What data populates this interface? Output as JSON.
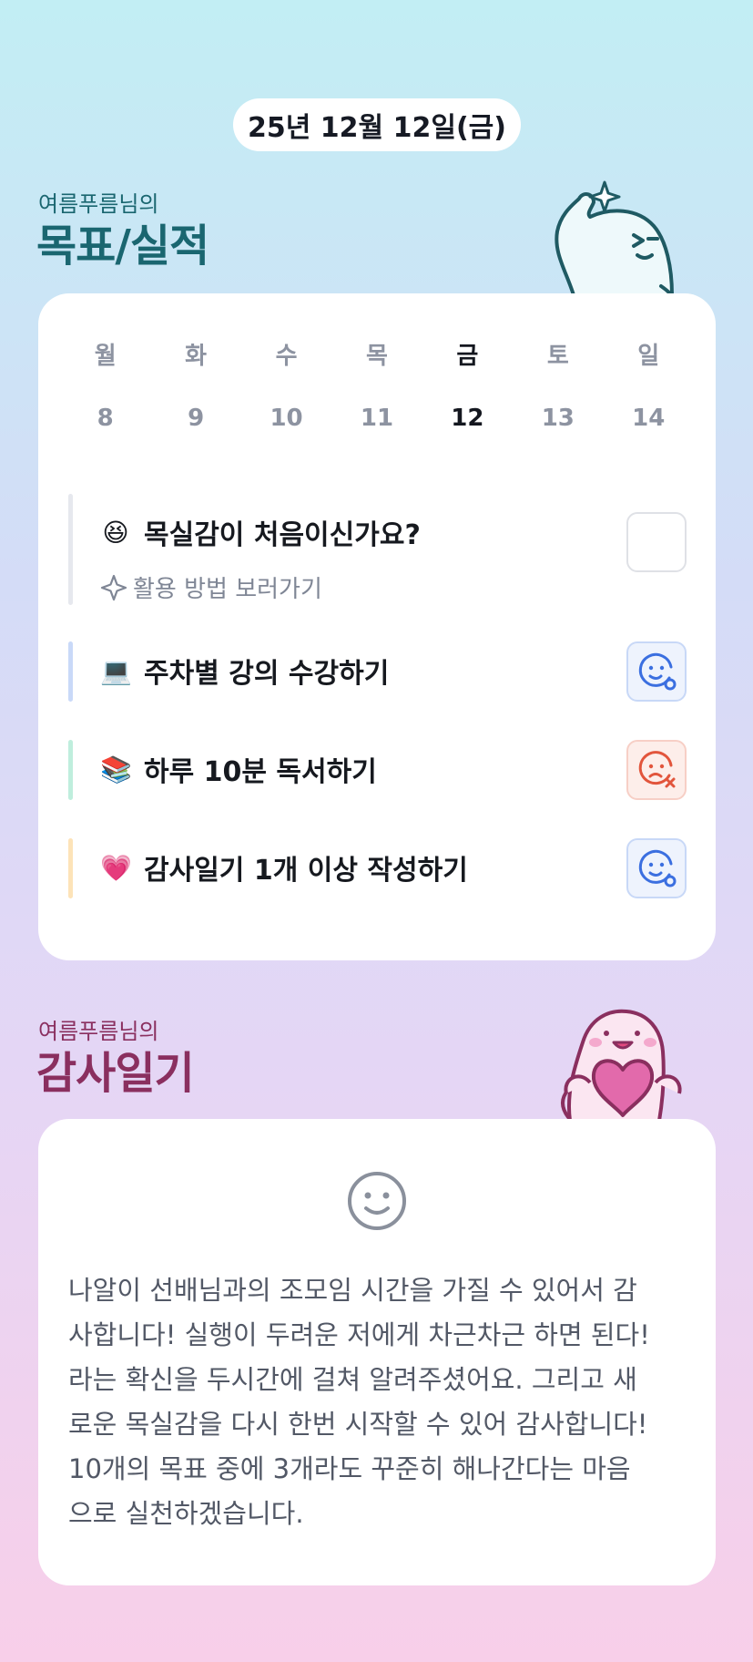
{
  "date": "25년 12월 12일(금)",
  "goals_section": {
    "subtitle": "여름푸름님의",
    "title": "목표/실적"
  },
  "week": {
    "days": [
      "월",
      "화",
      "수",
      "목",
      "금",
      "토",
      "일"
    ],
    "dates": [
      "8",
      "9",
      "10",
      "11",
      "12",
      "13",
      "14"
    ],
    "selected_index": 4
  },
  "goals": [
    {
      "emoji": "😆",
      "title": "목실감이 처음이신가요?",
      "link_label": "활용 방법 보러가기",
      "bar_color": "#e6e8ee",
      "status": "empty"
    },
    {
      "emoji": "💻",
      "title": "주차별 강의 수강하기",
      "bar_color": "#c9d9f8",
      "status": "done"
    },
    {
      "emoji": "📚",
      "title": "하루 10분 독서하기",
      "bar_color": "#bfeedd",
      "status": "failed"
    },
    {
      "emoji": "💗",
      "title": "감사일기 1개 이상 작성하기",
      "bar_color": "#fde3b8",
      "status": "done"
    }
  ],
  "diary_section": {
    "subtitle": "여름푸름님의",
    "title": "감사일기"
  },
  "diary": {
    "icon": "smile-face-icon",
    "lines": [
      "나알이 선배님과의 조모임 시간을 가질 수 있어서 감",
      "사합니다! 실행이 두려운 저에게 차근차근 하면 된다!",
      "라는 확신을 두시간에 걸쳐 알려주셨어요. 그리고 새",
      "로운 목실감을 다시 한번 시작할 수 있어 감사합니다!",
      "10개의 목표 중에 3개라도 꾸준히 해나간다는 마음",
      "으로 실천하겠습니다."
    ]
  },
  "colors": {
    "goals_title": "#1a6670",
    "diary_title": "#8a2f5f",
    "status_done": "#3b6fe0",
    "status_failed": "#e2553c"
  }
}
